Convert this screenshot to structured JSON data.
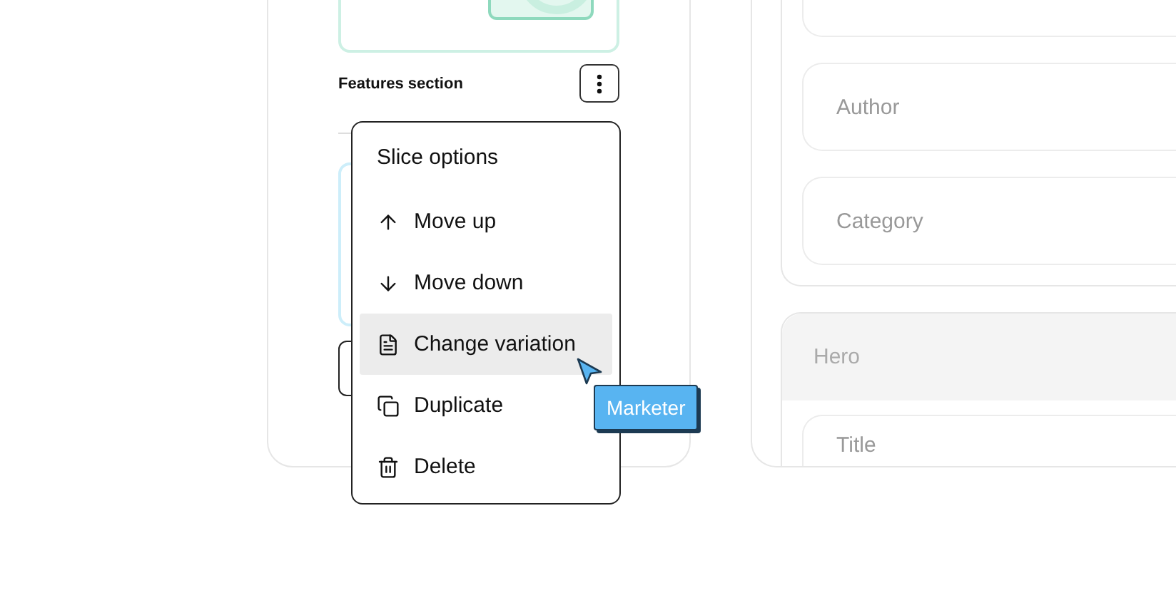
{
  "left_panel": {
    "slice_label": "Features section"
  },
  "menu": {
    "title": "Slice options",
    "items": [
      {
        "kind": "up",
        "label": "Move up",
        "selected": false
      },
      {
        "kind": "down",
        "label": "Move down",
        "selected": false
      },
      {
        "kind": "variation",
        "label": "Change variation",
        "selected": true
      },
      {
        "kind": "duplicate",
        "label": "Duplicate",
        "selected": false
      },
      {
        "kind": "delete",
        "label": "Delete",
        "selected": false
      }
    ]
  },
  "cursor": {
    "label": "Marketer"
  },
  "right_panel": {
    "fields": [
      {
        "placeholder": "Author"
      },
      {
        "placeholder": "Category"
      }
    ],
    "section": {
      "title": "Hero",
      "fields": [
        {
          "placeholder": "Title"
        }
      ]
    }
  }
}
